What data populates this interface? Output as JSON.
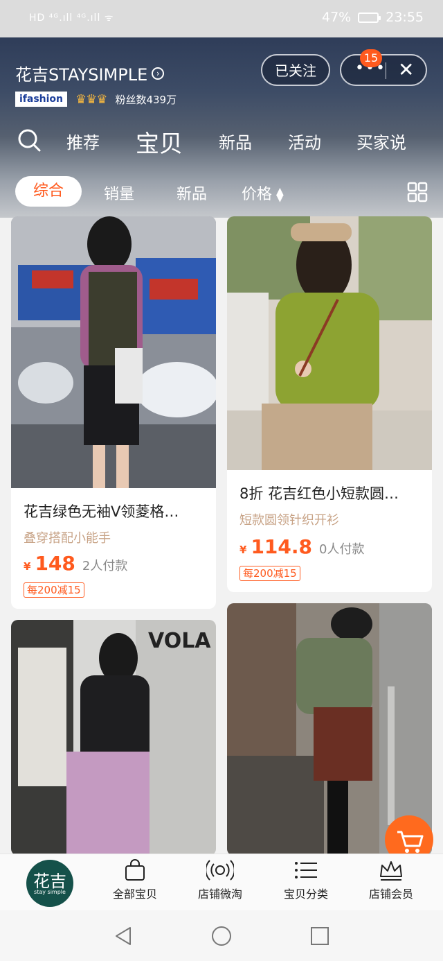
{
  "status_bar": {
    "left": "HD ⁴ᴳ.ıll ⁴ᴳ.ıll ᯤ",
    "battery": "47%",
    "time": "23:55"
  },
  "shop": {
    "name": "花吉STAYSIMPLE",
    "badge": "ifashion",
    "crowns": "♛♛♛",
    "fans": "粉丝数439万",
    "follow_label": "已关注",
    "more_label": "•••",
    "notification_count": "15",
    "close_label": "✕"
  },
  "nav_tabs": [
    "推荐",
    "宝贝",
    "新品",
    "活动",
    "买家说"
  ],
  "filters": {
    "active": "综合",
    "sales": "销量",
    "new": "新品",
    "price": "价格"
  },
  "products": [
    {
      "title": "花吉绿色无袖V领菱格…",
      "sub": "叠穿搭配小能手",
      "yen": "¥",
      "price": "148",
      "paid": "2人付款",
      "promo": "每200减15"
    },
    {
      "title": "8折 花吉红色小短款圆…",
      "sub": "短款圆领针织开衫",
      "yen": "¥",
      "price": "114.8",
      "paid": "0人付款",
      "promo": "每200减15"
    }
  ],
  "bottom_nav": {
    "logo_text": "花吉",
    "logo_sub": "stay simple",
    "items": [
      "全部宝贝",
      "店铺微淘",
      "宝贝分类",
      "店铺会员"
    ]
  },
  "colors": {
    "accent": "#ff5a1e",
    "header_dark": "#2f3d59",
    "logo_green": "#15514a"
  }
}
